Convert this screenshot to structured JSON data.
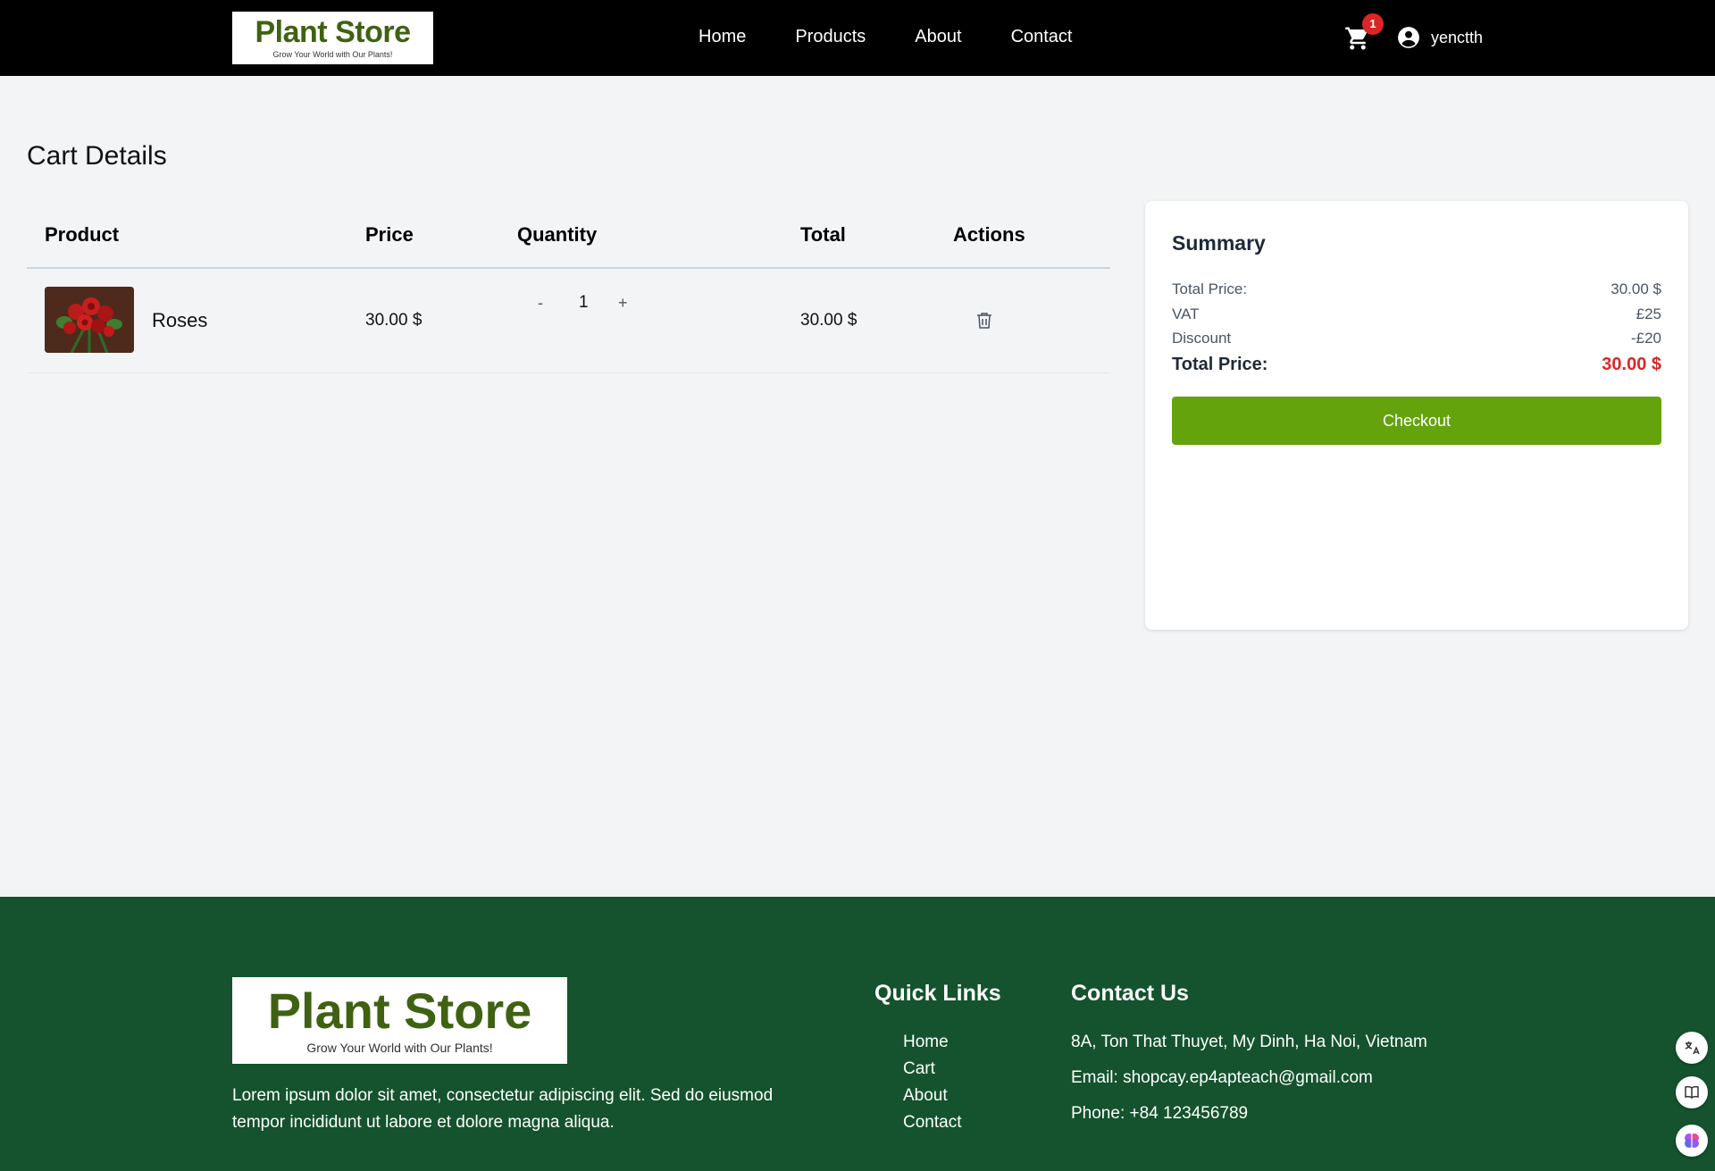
{
  "header": {
    "logo_title": "Plant Store",
    "logo_tagline": "Grow Your World with Our Plants!",
    "nav": [
      "Home",
      "Products",
      "About",
      "Contact"
    ],
    "cart_count": "1",
    "username": "yenctth"
  },
  "cart": {
    "title": "Cart Details",
    "columns": {
      "product": "Product",
      "price": "Price",
      "quantity": "Quantity",
      "total": "Total",
      "actions": "Actions"
    },
    "items": [
      {
        "name": "Roses",
        "price": "30.00 $",
        "decrement": "-",
        "quantity": "1",
        "increment": "+",
        "total": "30.00 $"
      }
    ]
  },
  "summary": {
    "title": "Summary",
    "rows": [
      {
        "label": "Total Price:",
        "value": "30.00 $"
      },
      {
        "label": "VAT",
        "value": "£25"
      },
      {
        "label": "Discount",
        "value": "-£20"
      }
    ],
    "grand_label": "Total Price:",
    "grand_value": "30.00 $",
    "checkout_label": "Checkout",
    "accent_color": "#65a30d",
    "total_color": "#dc2626"
  },
  "footer": {
    "logo_title": "Plant Store",
    "logo_tagline": "Grow Your World with Our Plants!",
    "description": "Lorem ipsum dolor sit amet, consectetur adipiscing elit. Sed do eiusmod tempor incididunt ut labore et dolore magna aliqua.",
    "quick_links_title": "Quick Links",
    "quick_links": [
      "Home",
      "Cart",
      "About",
      "Contact"
    ],
    "contact_title": "Contact Us",
    "address": "8A, Ton That Thuyet, My Dinh, Ha Noi, Vietnam",
    "email": "Email: shopcay.ep4apteach@gmail.com",
    "phone": "Phone: +84 123456789",
    "background_color": "#14532d"
  },
  "floating_icons": [
    "translate-icon",
    "book-icon",
    "brain-icon"
  ]
}
